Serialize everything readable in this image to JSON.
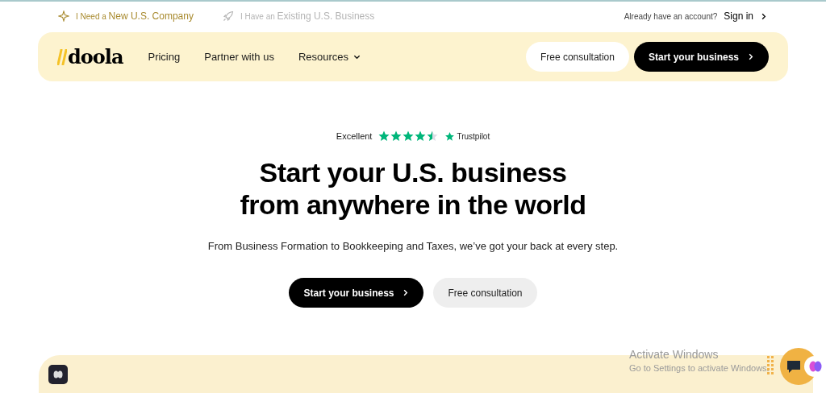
{
  "top_links": [
    {
      "text": "I Need a **New U.S. Company**",
      "selected": true
    },
    {
      "text": "I Have an **Existing U.S. Business**",
      "selected": false
    }
  ],
  "account": {
    "prompt": "Already have an account?",
    "link": "Sign in"
  },
  "nav": {
    "logo": "doola",
    "items": [
      {
        "label": "Pricing",
        "dropdown": false
      },
      {
        "label": "Partner with us",
        "dropdown": false
      },
      {
        "label": "Resources",
        "dropdown": true
      }
    ],
    "buttons": [
      {
        "label": "Free consultation",
        "kind": "secondary"
      },
      {
        "label": "Start your business",
        "kind": "primary"
      }
    ]
  },
  "hero": {
    "rating": {
      "label": "Excellent",
      "stars": 4.5,
      "brand": "Trustpilot"
    },
    "headline": [
      "Start your U.S. business",
      "from anywhere in the world"
    ],
    "subtitle": "From Business Formation to Bookkeeping and Taxes, we’ve got your back at every step.",
    "buttons": [
      {
        "label": "Start your business",
        "kind": "primary"
      },
      {
        "label": "Free consultation",
        "kind": "secondary"
      }
    ]
  },
  "os_notice": {
    "title": "Activate Windows",
    "text": "Go to Settings to activate Windows."
  }
}
